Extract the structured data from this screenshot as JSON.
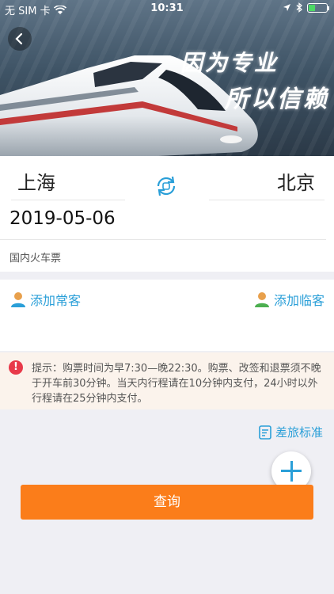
{
  "status_bar": {
    "carrier": "无 SIM 卡",
    "time": "10:31"
  },
  "banner": {
    "slogan_line1": "因为专业",
    "slogan_line2": "所以信赖"
  },
  "search": {
    "from_city": "上海",
    "to_city": "北京",
    "date": "2019-05-06",
    "ticket_type": "国内火车票"
  },
  "passengers": {
    "add_regular_label": "添加常客",
    "add_temp_label": "添加临客"
  },
  "notice": {
    "text": "提示：购票时间为早7:30—晚22:30。购票、改签和退票须不晚于开车前30分钟。当天内行程请在10分钟内支付，24小时以外行程请在25分钟内支付。"
  },
  "travel_standard_label": "差旅标准",
  "query_button_label": "查询",
  "colors": {
    "accent": "#2a9fd8",
    "primary_button": "#fb7d1a",
    "notice_bg": "#fbf3ec",
    "alert": "#e8394a"
  }
}
